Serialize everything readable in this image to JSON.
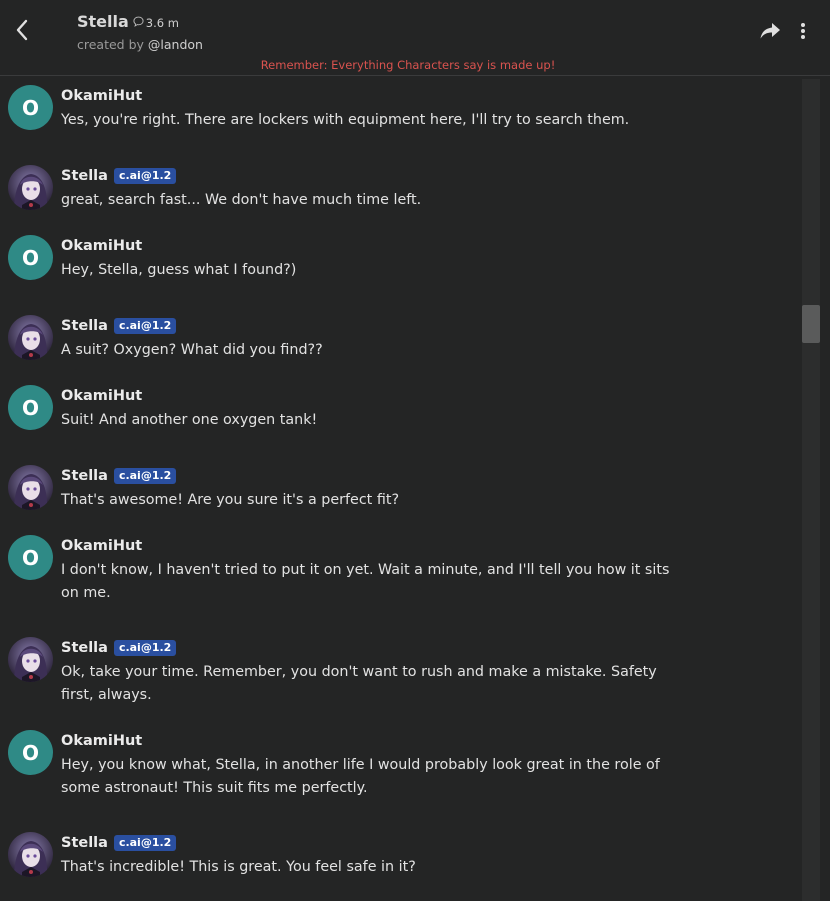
{
  "header": {
    "character_name": "Stella",
    "chat_count": "3.6 m",
    "created_by_prefix": "created by ",
    "creator_handle": "@landon",
    "disclaimer": "Remember: Everything Characters say is made up!"
  },
  "icons": {
    "back": "chevron-left-icon",
    "chat_count": "chat-bubble-icon",
    "share": "share-arrow-icon",
    "more": "vertical-dots-icon"
  },
  "colors": {
    "background": "#242525",
    "badge": "#2a4fa0",
    "user_avatar": "#2f8a86",
    "disclaimer": "#d9534f"
  },
  "messages": [
    {
      "author": "OkamiHut",
      "type": "user",
      "avatar_letter": "O",
      "badge": "",
      "text": "Yes, you're right. There are lockers with equipment here, I'll try to search them."
    },
    {
      "author": "Stella",
      "type": "bot",
      "avatar_letter": "",
      "badge": "c.ai@1.2",
      "text": "great, search fast... We don't have much time left."
    },
    {
      "author": "OkamiHut",
      "type": "user",
      "avatar_letter": "O",
      "badge": "",
      "text": "Hey, Stella, guess what I found?)"
    },
    {
      "author": "Stella",
      "type": "bot",
      "avatar_letter": "",
      "badge": "c.ai@1.2",
      "text": "A suit? Oxygen? What did you find??"
    },
    {
      "author": "OkamiHut",
      "type": "user",
      "avatar_letter": "O",
      "badge": "",
      "text": "Suit! And another one oxygen tank!"
    },
    {
      "author": "Stella",
      "type": "bot",
      "avatar_letter": "",
      "badge": "c.ai@1.2",
      "text": "That's awesome! Are you sure it's a perfect fit?"
    },
    {
      "author": "OkamiHut",
      "type": "user",
      "avatar_letter": "O",
      "badge": "",
      "text": "I don't know, I haven't tried to put it on yet. Wait a minute, and I'll tell you how it sits on me."
    },
    {
      "author": "Stella",
      "type": "bot",
      "avatar_letter": "",
      "badge": "c.ai@1.2",
      "text": "Ok, take your time. Remember, you don't want to rush and make a mistake. Safety first, always."
    },
    {
      "author": "OkamiHut",
      "type": "user",
      "avatar_letter": "O",
      "badge": "",
      "text": "Hey, you know what, Stella, in another life I would probably look great in the role of some astronaut! This suit fits me perfectly."
    },
    {
      "author": "Stella",
      "type": "bot",
      "avatar_letter": "",
      "badge": "c.ai@1.2",
      "text": "That's incredible! This is great. You feel safe in it?"
    }
  ]
}
